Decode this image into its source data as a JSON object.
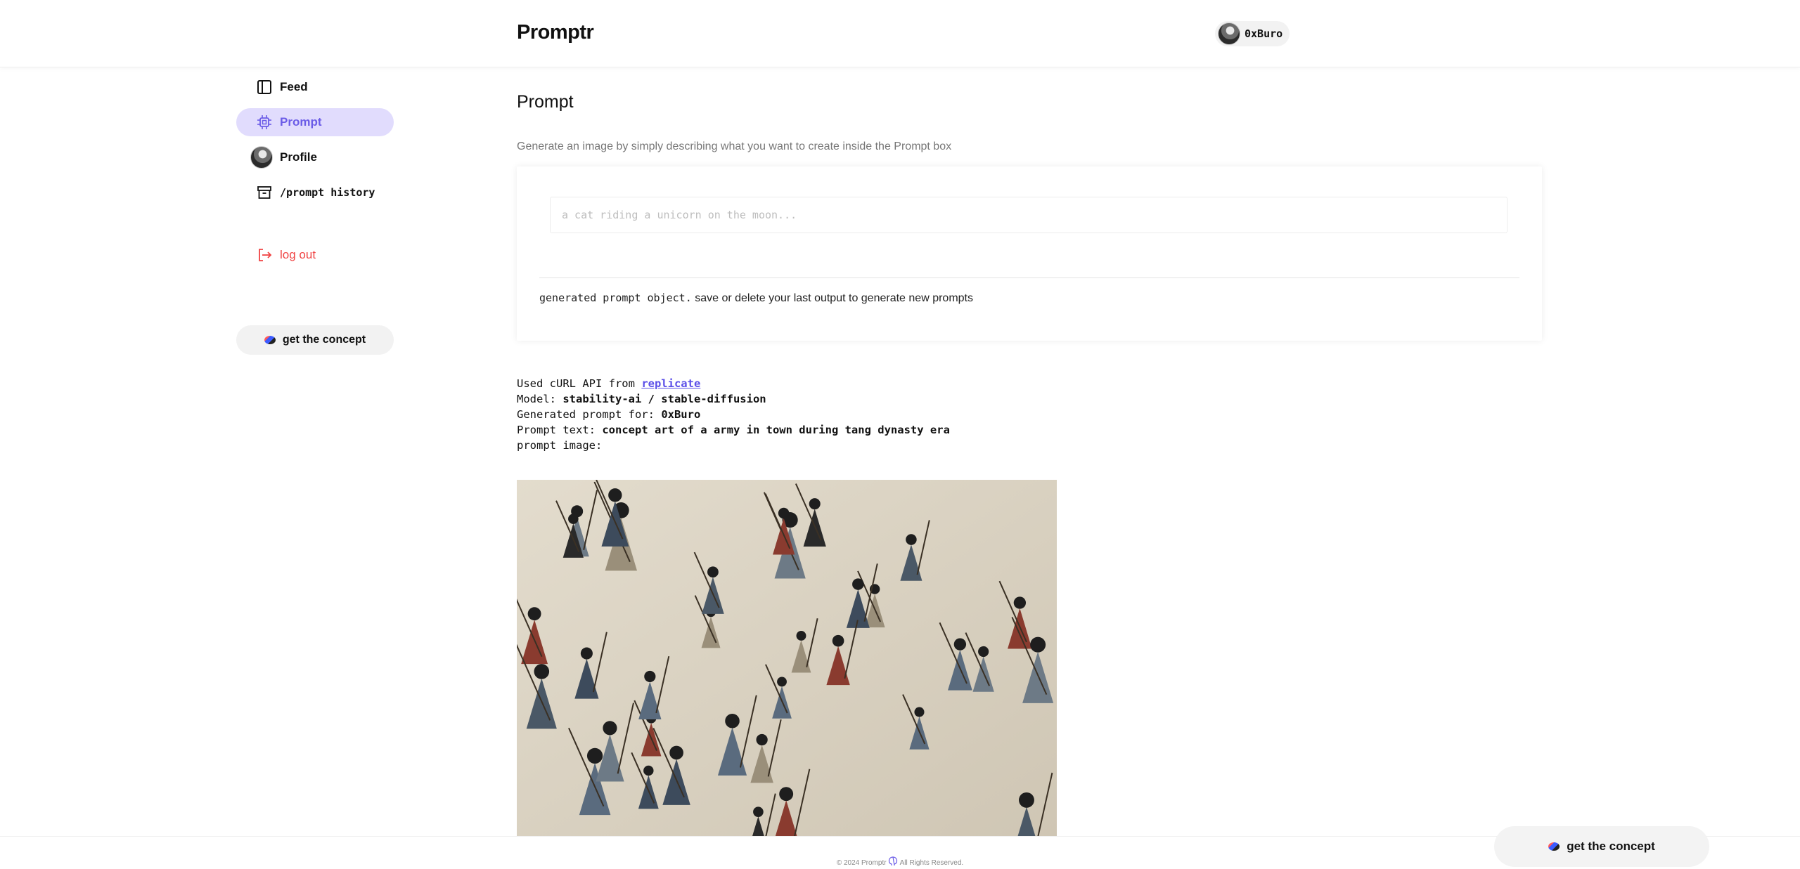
{
  "header": {
    "logo": "Promptr",
    "user_name": "0xBuro"
  },
  "sidebar": {
    "items": [
      {
        "label": "Feed",
        "icon": "sidebar-panel-icon"
      },
      {
        "label": "Prompt",
        "icon": "cpu-chip-icon",
        "active": true
      },
      {
        "label": "Profile",
        "icon": "avatar"
      },
      {
        "label": "/prompt history",
        "icon": "archive-box-icon"
      }
    ],
    "logout_label": "log out",
    "concept_label": "get the concept"
  },
  "main": {
    "title": "Prompt",
    "subtitle": "Generate an image by simply describing what you want to create inside the Prompt box",
    "prompt_placeholder": "a cat riding a unicorn on the moon...",
    "prompt_value": "",
    "status_code": "generated prompt object.",
    "status_text": " save or delete your last output to generate new prompts",
    "details": {
      "api_prefix": "Used cURL API from ",
      "api_link": "replicate",
      "model_label": "Model: ",
      "model_value": "stability-ai / stable-diffusion",
      "for_label": "Generated prompt for: ",
      "for_value": "0xBuro",
      "text_label": "Prompt text: ",
      "text_value": "concept art of a army in town during tang dynasty era",
      "image_label": "prompt image:"
    }
  },
  "footer": {
    "copyright_left": "© 2024 Promptr",
    "copyright_right": "All Rights Reserved."
  },
  "floating_button": "get the concept",
  "colors": {
    "accent": "#6b5ce7",
    "accent_bg": "#e1dcfd",
    "danger": "#f04444",
    "link": "#5b4fe8"
  }
}
